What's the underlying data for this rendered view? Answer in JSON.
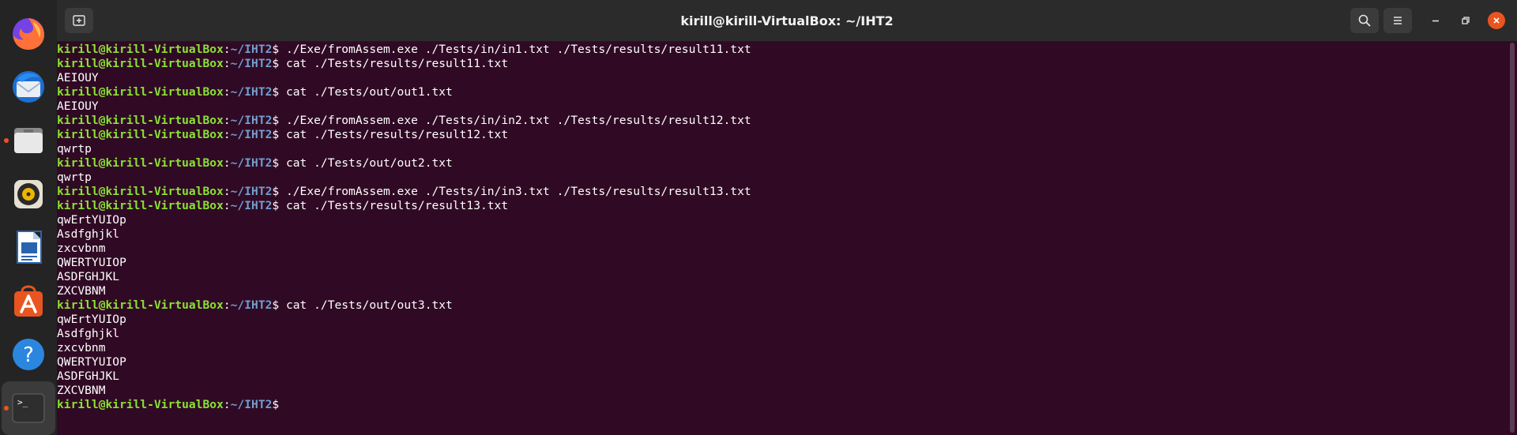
{
  "window": {
    "title": "kirill@kirill-VirtualBox: ~/IHT2"
  },
  "dock": {
    "items": [
      {
        "icon": "firefox-icon",
        "name": "Firefox"
      },
      {
        "icon": "thunderbird-icon",
        "name": "Thunderbird"
      },
      {
        "icon": "files-icon",
        "name": "Files",
        "running": true
      },
      {
        "icon": "rhythmbox-icon",
        "name": "Rhythmbox"
      },
      {
        "icon": "writer-icon",
        "name": "LibreOffice Writer"
      },
      {
        "icon": "software-icon",
        "name": "Ubuntu Software"
      },
      {
        "icon": "help-icon",
        "name": "Help"
      },
      {
        "icon": "terminal-icon",
        "name": "Terminal",
        "running": true,
        "active": true
      }
    ]
  },
  "prompt": {
    "user": "kirill@kirill-VirtualBox",
    "path": "~/IHT2",
    "sep": ":",
    "dollar": "$"
  },
  "lines": [
    {
      "type": "cmd",
      "text": " ./Exe/fromAssem.exe ./Tests/in/in1.txt ./Tests/results/result11.txt"
    },
    {
      "type": "cmd",
      "text": " cat ./Tests/results/result11.txt"
    },
    {
      "type": "out",
      "text": "AEIOUY"
    },
    {
      "type": "cmd",
      "text": " cat ./Tests/out/out1.txt"
    },
    {
      "type": "out",
      "text": "AEIOUY"
    },
    {
      "type": "cmd",
      "text": " ./Exe/fromAssem.exe ./Tests/in/in2.txt ./Tests/results/result12.txt"
    },
    {
      "type": "cmd",
      "text": " cat ./Tests/results/result12.txt"
    },
    {
      "type": "out",
      "text": "qwrtp"
    },
    {
      "type": "cmd",
      "text": " cat ./Tests/out/out2.txt"
    },
    {
      "type": "out",
      "text": "qwrtp"
    },
    {
      "type": "cmd",
      "text": " ./Exe/fromAssem.exe ./Tests/in/in3.txt ./Tests/results/result13.txt"
    },
    {
      "type": "cmd",
      "text": " cat ./Tests/results/result13.txt"
    },
    {
      "type": "out",
      "text": "qwErtYUIOp"
    },
    {
      "type": "out",
      "text": "Asdfghjkl"
    },
    {
      "type": "out",
      "text": "zxcvbnm"
    },
    {
      "type": "out",
      "text": "QWERTYUIOP"
    },
    {
      "type": "out",
      "text": "ASDFGHJKL"
    },
    {
      "type": "out",
      "text": "ZXCVBNM"
    },
    {
      "type": "cmd",
      "text": " cat ./Tests/out/out3.txt"
    },
    {
      "type": "out",
      "text": "qwErtYUIOp"
    },
    {
      "type": "out",
      "text": "Asdfghjkl"
    },
    {
      "type": "out",
      "text": "zxcvbnm"
    },
    {
      "type": "out",
      "text": "QWERTYUIOP"
    },
    {
      "type": "out",
      "text": "ASDFGHJKL"
    },
    {
      "type": "out",
      "text": "ZXCVBNM"
    },
    {
      "type": "cmd",
      "text": ""
    }
  ]
}
